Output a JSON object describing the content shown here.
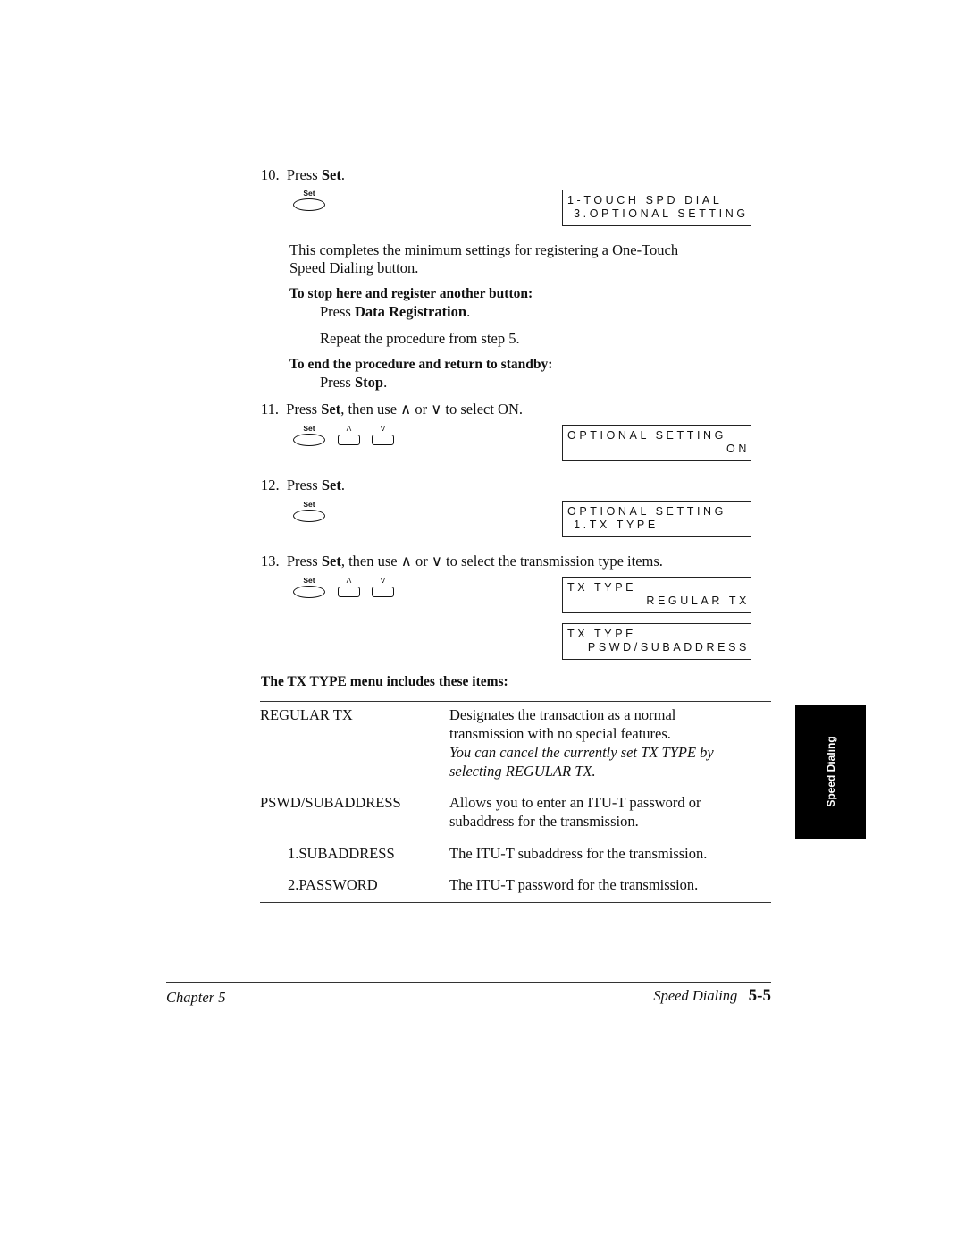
{
  "steps": {
    "s10": {
      "num": "10.",
      "pre": "Press ",
      "bold": "Set",
      "post": "."
    },
    "s10_note": "This completes the minimum settings for registering a One-Touch",
    "s10_note2": "Speed Dialing button.",
    "stop_heading": "To stop here and register another button:",
    "stop_press": "Press ",
    "stop_bold": "Data Registration",
    "stop_post": ".",
    "repeat": "Repeat the procedure from step 5.",
    "end_heading": "To end the procedure and return to standby:",
    "end_press": "Press ",
    "end_bold": "Stop",
    "end_post": ".",
    "s11": {
      "num": "11.",
      "pre": "Press ",
      "bold": "Set",
      "post": ", then use ∧ or ∨ to select ON."
    },
    "s12": {
      "num": "12.",
      "pre": "Press ",
      "bold": "Set",
      "post": "."
    },
    "s13": {
      "num": "13.",
      "pre": "Press ",
      "bold": "Set",
      "post": ", then use ∧ or ∨ to select the transmission type items."
    }
  },
  "keys": {
    "set": "Set",
    "up": "Λ",
    "down": "V"
  },
  "lcd": [
    {
      "l1": "1-TOUCH SPD DIAL",
      "l2": " 3.OPTIONAL SETTING"
    },
    {
      "l1": "OPTIONAL SETTING",
      "l2": "ON"
    },
    {
      "l1": "OPTIONAL SETTING",
      "l2": " 1.TX TYPE"
    },
    {
      "l1": "TX TYPE",
      "l2": "REGULAR TX"
    },
    {
      "l1": "TX TYPE",
      "l2": "PSWD/SUBADDRESS"
    }
  ],
  "table": {
    "heading": "The TX TYPE menu includes these items:",
    "rows": [
      {
        "term": "REGULAR TX",
        "d1": "Designates the transaction as a normal",
        "d2": "transmission with no special features.",
        "n1": "You can cancel the currently set TX TYPE by",
        "n2": "selecting REGULAR TX."
      },
      {
        "term": "PSWD/SUBADDRESS",
        "d1": "Allows you to enter an ITU-T password or",
        "d2": "subaddress for the transmission."
      },
      {
        "term": "1.SUBADDRESS",
        "d1": "The ITU-T subaddress for the transmission."
      },
      {
        "term": "2.PASSWORD",
        "d1": "The ITU-T password for the transmission."
      }
    ]
  },
  "side_tab": "Speed Dialing",
  "footer": {
    "chapter": "Chapter 5",
    "section": "Speed Dialing",
    "page": "5-5"
  }
}
